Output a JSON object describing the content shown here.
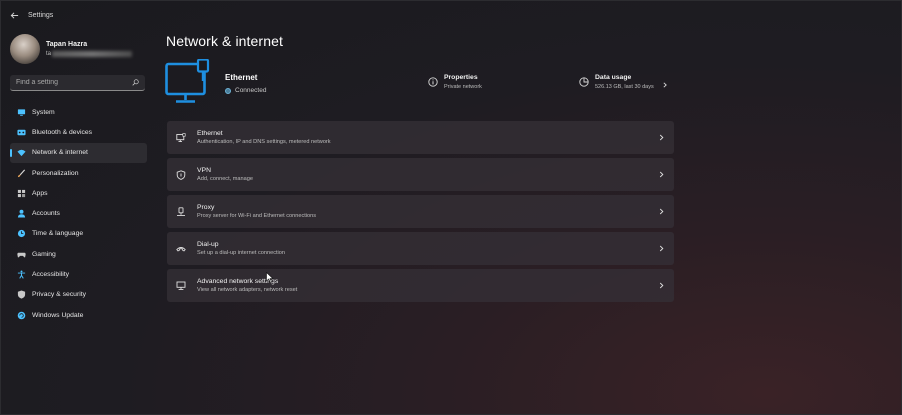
{
  "window": {
    "title": "Settings"
  },
  "profile": {
    "name": "Tapan Hazra",
    "email_visible": "ta"
  },
  "search": {
    "placeholder": "Find a setting"
  },
  "sidebar": {
    "items": [
      {
        "label": "System",
        "icon": "monitor-icon",
        "color": "#4cc2ff"
      },
      {
        "label": "Bluetooth & devices",
        "icon": "bluetooth-icon",
        "color": "#4cc2ff"
      },
      {
        "label": "Network & internet",
        "icon": "wifi-icon",
        "color": "#4cc2ff",
        "active": true
      },
      {
        "label": "Personalization",
        "icon": "brush-icon",
        "color": "#e8a45a"
      },
      {
        "label": "Apps",
        "icon": "apps-icon",
        "color": "#c8c8c8"
      },
      {
        "label": "Accounts",
        "icon": "person-icon",
        "color": "#4cc2ff"
      },
      {
        "label": "Time & language",
        "icon": "globe-clock-icon",
        "color": "#4cc2ff"
      },
      {
        "label": "Gaming",
        "icon": "controller-icon",
        "color": "#c8c8c8"
      },
      {
        "label": "Accessibility",
        "icon": "accessibility-icon",
        "color": "#4cc2ff"
      },
      {
        "label": "Privacy & security",
        "icon": "shield-icon",
        "color": "#c8c8c8"
      },
      {
        "label": "Windows Update",
        "icon": "update-icon",
        "color": "#4cc2ff"
      }
    ]
  },
  "main": {
    "title": "Network & internet",
    "hero": {
      "title": "Ethernet",
      "status": "Connected",
      "accent": "#1e8fe0"
    },
    "properties": {
      "title": "Properties",
      "subtitle": "Private network"
    },
    "data_usage": {
      "title": "Data usage",
      "subtitle": "526.13 GB, last 30 days"
    },
    "cards": [
      {
        "title": "Ethernet",
        "subtitle": "Authentication, IP and DNS settings, metered network",
        "icon": "ethernet-monitor-icon"
      },
      {
        "title": "VPN",
        "subtitle": "Add, connect, manage",
        "icon": "vpn-shield-icon"
      },
      {
        "title": "Proxy",
        "subtitle": "Proxy server for Wi-Fi and Ethernet connections",
        "icon": "proxy-icon"
      },
      {
        "title": "Dial-up",
        "subtitle": "Set up a dial-up internet connection",
        "icon": "phone-icon"
      },
      {
        "title": "Advanced network settings",
        "subtitle": "View all network adapters, network reset",
        "icon": "network-pc-icon"
      }
    ]
  }
}
